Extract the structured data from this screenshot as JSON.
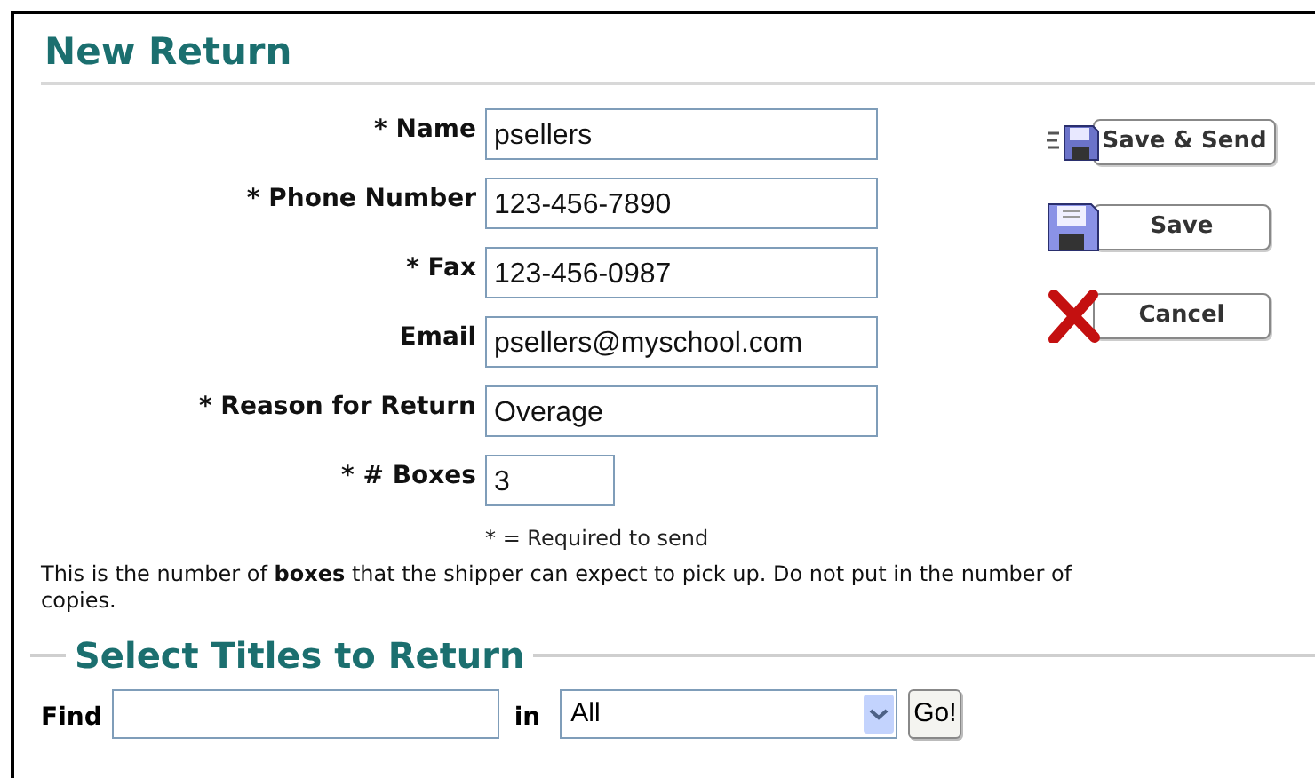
{
  "title": "New Return",
  "fields": [
    {
      "label": "* Name",
      "value": "psellers",
      "kind": "wide"
    },
    {
      "label": "* Phone Number",
      "value": "123-456-7890",
      "kind": "wide"
    },
    {
      "label": "* Fax",
      "value": "123-456-0987",
      "kind": "wide"
    },
    {
      "label": "Email",
      "value": "psellers@myschool.com",
      "kind": "wide"
    },
    {
      "label": "* Reason for Return",
      "value": "Overage",
      "kind": "wide"
    },
    {
      "label": "* # Boxes",
      "value": "3",
      "kind": "short"
    }
  ],
  "note": "* = Required to send",
  "help": "This is the number of **boxes** that the shipper can expect to pick up. Do not put in the number of copies.",
  "buttons": [
    {
      "label": "Save & Send",
      "kind": "save_send"
    },
    {
      "label": "Save",
      "kind": "save"
    },
    {
      "label": "Cancel",
      "kind": "cancel"
    }
  ],
  "section": {
    "title": "Select Titles to Return",
    "find_label": "Find",
    "in_label": "in",
    "scope": "All",
    "go": "Go!"
  }
}
